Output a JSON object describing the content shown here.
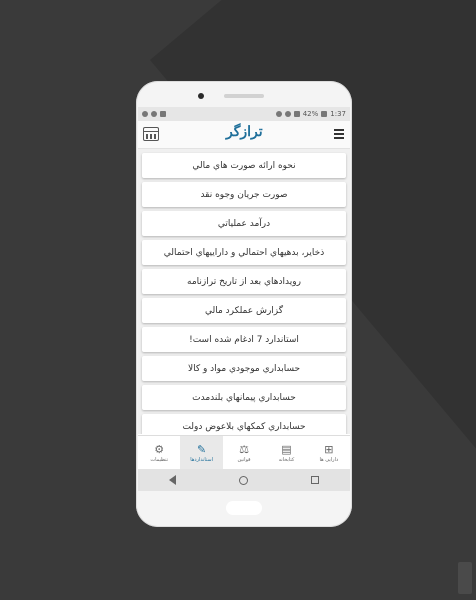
{
  "statusbar": {
    "battery": "42%",
    "time": "1:37"
  },
  "appbar": {
    "logo": "ترازگر",
    "menu_icon": "hamburger-menu-icon",
    "calendar_icon": "calendar-icon"
  },
  "list": {
    "items": [
      "نحوه ارائه صورت هاي مالي",
      "صورت جريان وجوه نقد",
      "درآمد عملياتي",
      "ذخاير، بدهيهاي احتمالي و داراييهاي احتمالي",
      "رويدادهاي بعد از تاريخ ترازنامه",
      "گزارش عملکرد مالي",
      "استاندارد 7 ادغام شده است!",
      "حسابداري موجودي مواد و کالا",
      "حسابداري پيمانهاي بلندمدت",
      "حسابداري کمکهاي بلاعوض دولت"
    ]
  },
  "tabbar": {
    "tabs": [
      {
        "label": "تنظیمات",
        "icon": "gear-icon"
      },
      {
        "label": "استانداردها",
        "icon": "pen-icon"
      },
      {
        "label": "قوانین",
        "icon": "scales-icon"
      },
      {
        "label": "کتابخانه",
        "icon": "books-icon"
      },
      {
        "label": "دارایی ها",
        "icon": "grid-plus-icon"
      }
    ],
    "active_index": 1,
    "accent": "#1f6f9a"
  }
}
